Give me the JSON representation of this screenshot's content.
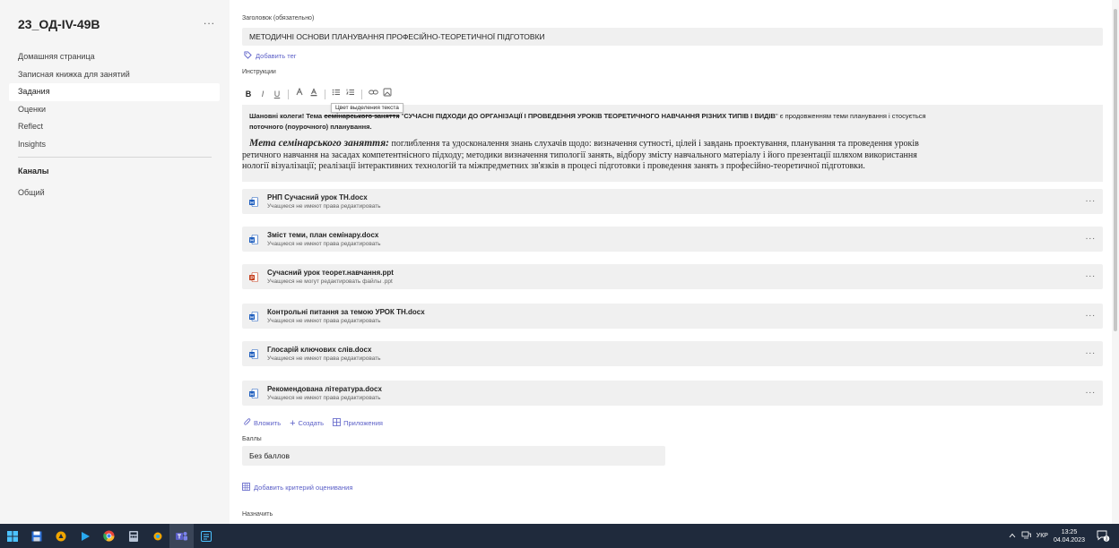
{
  "sidebar": {
    "team_title": "23_ОД-IV-49В",
    "more": "...",
    "items": [
      {
        "label": "Домашняя страница",
        "active": false
      },
      {
        "label": "Записная книжка для занятий",
        "active": false
      },
      {
        "label": "Задания",
        "active": true
      },
      {
        "label": "Оценки",
        "active": false
      },
      {
        "label": "Reflect",
        "active": false
      },
      {
        "label": "Insights",
        "active": false
      }
    ],
    "channels_title": "Каналы",
    "channels": [
      {
        "label": "Общий"
      }
    ]
  },
  "form": {
    "title_label": "Заголовок (обязательно)",
    "title_value": "МЕТОДИЧНІ ОСНОВИ ПЛАНУВАННЯ ПРОФЕСІЙНО-ТЕОРЕТИЧНОЇ ПІДГОТОВКИ",
    "add_tag": "Добавить тег",
    "instructions_label": "Инструкции",
    "tooltip": "Цвет выделения текста",
    "toolbar": {
      "bold": "B",
      "italic": "I",
      "underline": "U"
    },
    "instructions": {
      "p1_start": "Шановні колеги! Тема ",
      "p1_strike": "семінарського заняття",
      "p1_mid": " \"",
      "p1_bold": "СУЧАСНІ ПІДХОДИ ДО ОРГАНІЗАЦІЇ І ПРОВЕДЕННЯ УРОКІВ ТЕОРЕТИЧНОГО НАВЧАННЯ РІЗНИХ ТИПІВ І ВИДІВ",
      "p1_end": "\" є продовженням теми планування і стосується",
      "p1_line2": "поточного (поурочного) планування.",
      "p2_heading": "Мета семінарського заняття:",
      "p2_text1": " поглиблення  та удосконалення знань слухачів щодо: визначення сутності,  цілей і завдань проектування, планування та проведення уроків",
      "p2_text2": "ретичного навчання на засадах компетентнісного підходу;  методики визначення типології занять, відбору змісту навчального матеріалу і його презентації шляхом використання",
      "p2_text3": "нології візуалізації; реалізації інтерактивних технологій та міжпредметних зв'язків в процесі підготовки і проведення занять з професійно-теоретичної підготовки."
    },
    "attachments": [
      {
        "name": "РНП Сучасний урок ТН.docx",
        "note": "Учащиеся не имеют права редактировать",
        "type": "word"
      },
      {
        "name": "Зміст теми, план семінару.docx",
        "note": "Учащиеся не имеют права редактировать",
        "type": "word"
      },
      {
        "name": "Сучасний урок теорет.навчання.ppt",
        "note": "Учащиеся не могут редактировать файлы .ppt",
        "type": "ppt"
      },
      {
        "name": "Контрольні питання за темою УРОК ТН.docx",
        "note": "Учащиеся не имеют права редактировать",
        "type": "word"
      },
      {
        "name": "Глосарій ключових слів.docx",
        "note": "Учащиеся не имеют права редактировать",
        "type": "word"
      },
      {
        "name": "Рекомендована література.docx",
        "note": "Учащиеся не имеют права редактировать",
        "type": "word"
      }
    ],
    "attachment_more": "...",
    "actions": {
      "attach": "Вложить",
      "create": "Создать",
      "apps": "Приложения"
    },
    "points_label": "Баллы",
    "points_value": "Без баллов",
    "add_rubric": "Добавить критерий оценивания",
    "assign_label": "Назначить"
  },
  "taskbar": {
    "lang": "УКР",
    "time": "13:25",
    "date": "04.04.2023",
    "notifications": "3"
  },
  "colors": {
    "accent": "#5b5fc7",
    "word": "#185abd",
    "ppt": "#c43e1c",
    "taskbar": "#1f2a3c"
  }
}
